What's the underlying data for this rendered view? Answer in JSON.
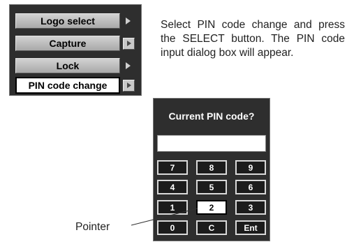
{
  "menu": {
    "items": [
      {
        "label": "Logo select",
        "arrow": "plain"
      },
      {
        "label": "Capture",
        "arrow": "boxed"
      },
      {
        "label": "Lock",
        "arrow": "plain"
      },
      {
        "label": "PIN code change",
        "arrow": "boxed",
        "active": true
      }
    ]
  },
  "instructions": "Select PIN code change and press the SELECT button. The PIN code input dialog box will appear.",
  "dialog": {
    "title": "Current PIN code?",
    "input_value": "",
    "keys": [
      "7",
      "8",
      "9",
      "4",
      "5",
      "6",
      "1",
      "2",
      "3",
      "0",
      "C",
      "Ent"
    ],
    "selected_key": "2"
  },
  "annotation": {
    "pointer_label": "Pointer"
  }
}
